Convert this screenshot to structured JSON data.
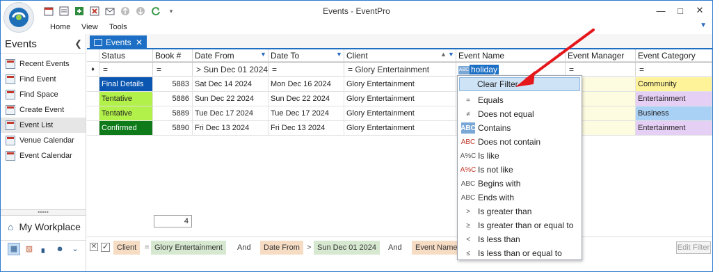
{
  "window": {
    "title": "Events - EventPro"
  },
  "menu": [
    "Home",
    "View",
    "Tools"
  ],
  "sidebar": {
    "title": "Events",
    "items": [
      "Recent Events",
      "Find Event",
      "Find Space",
      "Create Event",
      "Event List",
      "Venue Calendar",
      "Event Calendar"
    ],
    "workplace": "My Workplace"
  },
  "tab": {
    "label": "Events"
  },
  "grid": {
    "columns": [
      "Status",
      "Book #",
      "Date From",
      "Date To",
      "Client",
      "Event Name",
      "Event Manager",
      "Event Category"
    ],
    "filter_row": {
      "status": "=",
      "book": "=",
      "date_from": "> Sun Dec 01 2024",
      "date_to": "=",
      "client": "= Glory Entertainment",
      "event_name": "holiday",
      "event_manager": "=",
      "event_category": "="
    },
    "rows": [
      {
        "status": "Final Details",
        "status_color": "#0a56b0",
        "book": "5883",
        "from": "Sat Dec 14 2024",
        "to": "Mon Dec 16 2024",
        "client": "Glory Entertainment",
        "category": "Community",
        "cat_color": "#fff39a"
      },
      {
        "status": "Tentative",
        "status_color": "#b2f04a",
        "book": "5886",
        "from": "Sun Dec 22 2024",
        "to": "Sun Dec 22 2024",
        "client": "Glory Entertainment",
        "category": "Entertainment",
        "cat_color": "#e6cff5"
      },
      {
        "status": "Tentative",
        "status_color": "#b2f04a",
        "book": "5889",
        "from": "Tue Dec 17 2024",
        "to": "Tue Dec 17 2024",
        "client": "Glory Entertainment",
        "category": "Business",
        "cat_color": "#a9d1f5"
      },
      {
        "status": "Confirmed",
        "status_color": "#0e7a1a",
        "book": "5890",
        "from": "Fri Dec 13 2024",
        "to": "Fri Dec 13 2024",
        "client": "Glory Entertainment",
        "category": "Entertainment",
        "cat_color": "#e6cff5"
      }
    ],
    "total": "4"
  },
  "filter_panel": {
    "clear": "Clear Filter",
    "options": [
      "Equals",
      "Does not equal",
      "Contains",
      "Does not contain",
      "Is like",
      "Is not like",
      "Begins with",
      "Ends with",
      "Is greater than",
      "Is greater than or equal to",
      "Is less than",
      "Is less than or equal to"
    ]
  },
  "filter_bar": {
    "client_label": "Client",
    "op1": "=",
    "client_value": "Glory Entertainment",
    "and1": "And",
    "datefrom_label": "Date From",
    "op2": ">",
    "datefrom_value": "Sun Dec 01 2024",
    "and2": "And",
    "eventname_label": "Event Name",
    "edit": "Edit Filter"
  }
}
